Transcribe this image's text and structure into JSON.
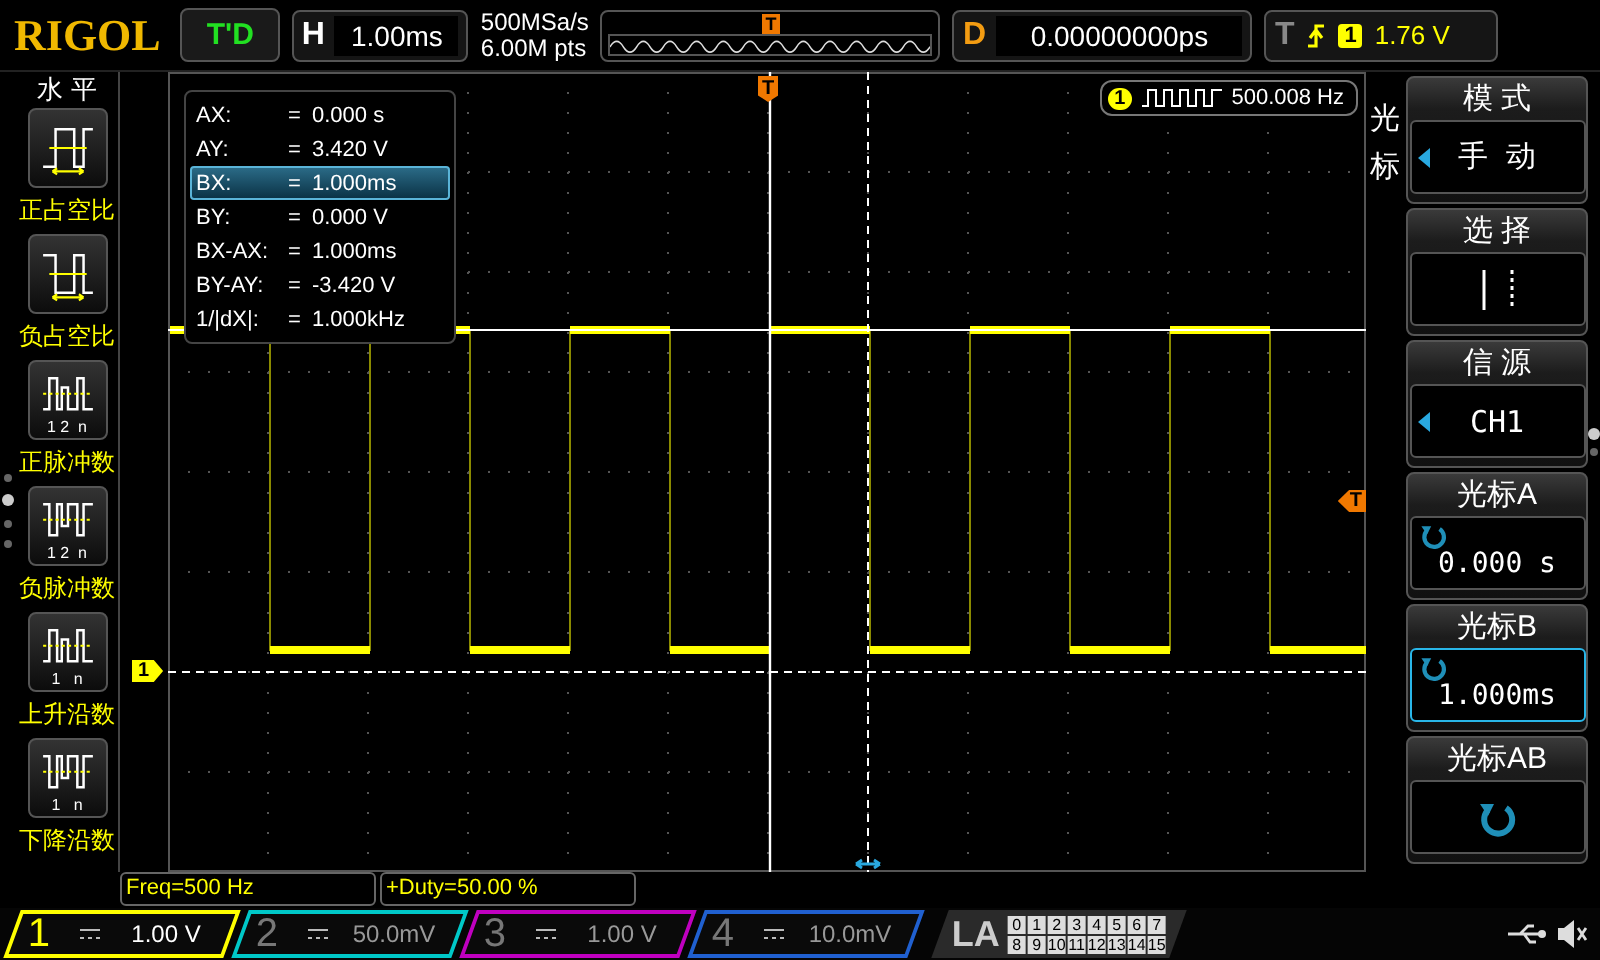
{
  "top_bar": {
    "logo": "RIGOL",
    "run_state": "T'D",
    "horizontal": {
      "label": "H",
      "value": "1.00ms"
    },
    "sample_rate": "500MSa/s",
    "memory_depth": "6.00M pts",
    "overview_marker": "T",
    "delay": {
      "label": "D",
      "value": "0.00000000ps"
    },
    "trigger": {
      "label": "T",
      "source": "1",
      "level": "1.76 V"
    }
  },
  "left_menu": {
    "title": "水 平",
    "items": [
      {
        "kind": "pos-duty",
        "label": "正占空比"
      },
      {
        "kind": "neg-duty",
        "label": "负占空比"
      },
      {
        "kind": "pos-pulses",
        "label": "正脉冲数",
        "caption": "1 2  n"
      },
      {
        "kind": "neg-pulses",
        "label": "负脉冲数",
        "caption": "1 2  n"
      },
      {
        "kind": "rising",
        "label": "上升沿数",
        "caption": "1   n"
      },
      {
        "kind": "falling",
        "label": "下降沿数",
        "caption": "1   n"
      }
    ]
  },
  "plot": {
    "trigger_marker": "T",
    "level_marker": "T",
    "channel_marker": "1",
    "frequency_badge": {
      "channel": "1",
      "value": "500.008 Hz"
    },
    "cursor_readout": [
      {
        "name": "AX:",
        "sign": "=",
        "value": "0.000 s",
        "selected": false
      },
      {
        "name": "AY:",
        "sign": "=",
        "value": "3.420 V",
        "selected": false
      },
      {
        "name": "BX:",
        "sign": "=",
        "value": "1.000ms",
        "selected": true
      },
      {
        "name": "BY:",
        "sign": "=",
        "value": "0.000 V",
        "selected": false
      },
      {
        "name": "BX-AX:",
        "sign": "=",
        "value": "1.000ms",
        "selected": false
      },
      {
        "name": "BY-AY:",
        "sign": "=",
        "value": "-3.420 V",
        "selected": false
      },
      {
        "name": "1/|dX|:",
        "sign": "=",
        "value": "1.000kHz",
        "selected": false
      }
    ]
  },
  "measurements": [
    "Freq=500 Hz",
    "+Duty=50.00 %"
  ],
  "right_menu": {
    "title": "光标",
    "items": [
      {
        "kind": "option",
        "label": "模 式",
        "value": "手 动",
        "selected": false
      },
      {
        "kind": "selector",
        "label": "选 择",
        "selected": false
      },
      {
        "kind": "option",
        "label": "信 源",
        "value": "CH1",
        "selected": false
      },
      {
        "kind": "knob",
        "label": "光标A",
        "value": "0.000 s",
        "selected": false
      },
      {
        "kind": "knob",
        "label": "光标B",
        "value": "1.000ms",
        "selected": true
      },
      {
        "kind": "knob",
        "label": "光标AB",
        "selected": false
      }
    ]
  },
  "channels": [
    {
      "number": "1",
      "scale": "1.00 V",
      "selected": true,
      "color": "#ffff00"
    },
    {
      "number": "2",
      "scale": "50.0mV",
      "selected": false,
      "color": "#00c8c8"
    },
    {
      "number": "3",
      "scale": "1.00 V",
      "selected": false,
      "color": "#c000c0"
    },
    {
      "number": "4",
      "scale": "10.0mV",
      "selected": false,
      "color": "#2060d0"
    }
  ],
  "logic_analyzer": {
    "label": "LA",
    "rows": [
      [
        "0",
        "1",
        "2",
        "3",
        "4",
        "5",
        "6",
        "7"
      ],
      [
        "8",
        "9",
        "10",
        "11",
        "12",
        "13",
        "14",
        "15"
      ]
    ]
  }
}
